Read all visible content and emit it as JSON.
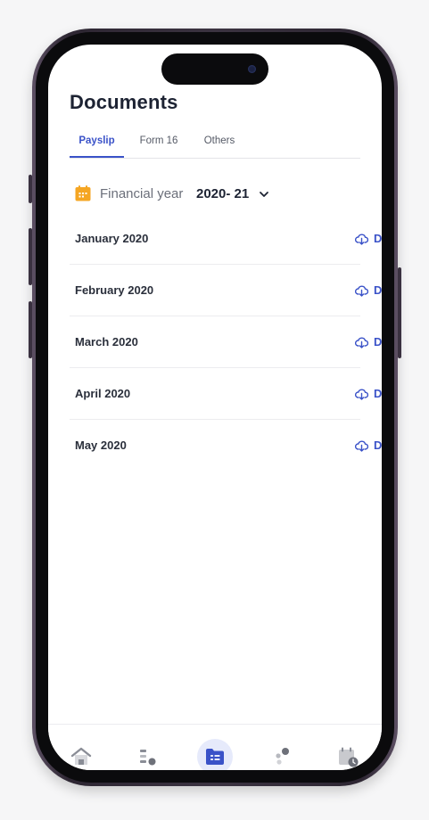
{
  "page": {
    "title": "Documents"
  },
  "tabs": [
    {
      "label": "Payslip",
      "active": true
    },
    {
      "label": "Form 16",
      "active": false
    },
    {
      "label": "Others",
      "active": false
    }
  ],
  "financial_year": {
    "label": "Financial year",
    "value": "2020- 21",
    "icon": "calendar-icon"
  },
  "payslips": [
    {
      "month": "January 2020",
      "action": "Download"
    },
    {
      "month": "February 2020",
      "action": "Download"
    },
    {
      "month": "March 2020",
      "action": "Download"
    },
    {
      "month": "April 2020",
      "action": "Download"
    },
    {
      "month": "May 2020",
      "action": "Download"
    }
  ],
  "bottom_nav": {
    "items": [
      {
        "icon": "home-icon",
        "active": false
      },
      {
        "icon": "list-icon",
        "active": false
      },
      {
        "icon": "documents-folder-icon",
        "active": true
      },
      {
        "icon": "dots-icon",
        "active": false
      },
      {
        "icon": "calendar-clock-icon",
        "active": false
      }
    ]
  },
  "colors": {
    "accent": "#3a52c8",
    "calendar_orange": "#f5a623",
    "title_text": "#1d2333",
    "muted_text": "#6b6f7a"
  }
}
